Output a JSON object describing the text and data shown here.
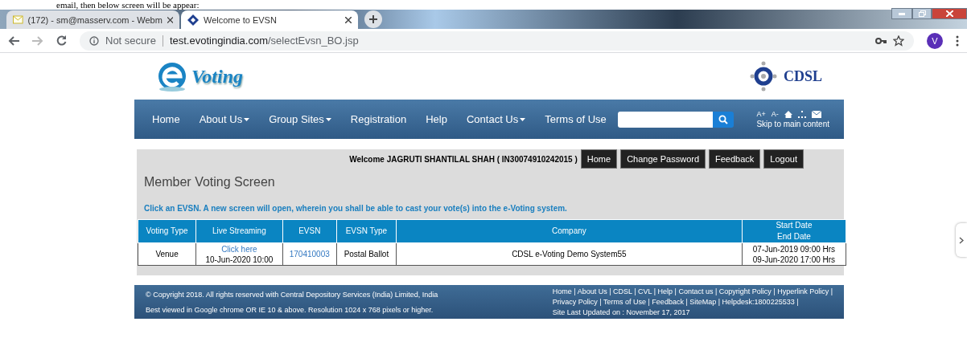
{
  "document_line": "email, then below screen will be appear:",
  "browser": {
    "tabs": [
      {
        "title": "(172) - sm@masserv.com - Webm",
        "selected": false,
        "kind": "mail"
      },
      {
        "title": "Welcome to EVSN",
        "selected": true,
        "kind": "site"
      }
    ],
    "security": "Not secure",
    "url_host": "test.evotingindia.com",
    "url_path": "/selectEvsn_BO.jsp",
    "profile": "V"
  },
  "header": {
    "logo_text": "Voting",
    "brand": "CDSL"
  },
  "nav": {
    "items": [
      {
        "label": "Home",
        "dropdown": false
      },
      {
        "label": "About Us",
        "dropdown": true
      },
      {
        "label": "Group Sites",
        "dropdown": true
      },
      {
        "label": "Registration",
        "dropdown": false
      },
      {
        "label": "Help",
        "dropdown": false
      },
      {
        "label": "Contact Us",
        "dropdown": true
      },
      {
        "label": "Terms of Use",
        "dropdown": false
      }
    ],
    "font_up": "A+",
    "font_down": "A-",
    "skip_link": "Skip to main content"
  },
  "panel": {
    "welcome": "Welcome JAGRUTI SHANTILAL SHAH ( IN30074910242015 )",
    "buttons": [
      "Home",
      "Change Password",
      "Feedback",
      "Logout"
    ],
    "title": "Member Voting Screen",
    "instruction": "Click an EVSN. A new screen will open, wherein you shall be able to cast your vote(s) into the e-Voting system.",
    "table": {
      "columns": [
        "Voting Type",
        "Live Streaming",
        "EVSN",
        "EVSN Type",
        "Company",
        [
          "Start Date",
          "End Date"
        ]
      ],
      "rows": [
        {
          "voting_type": "Venue",
          "live_link": "Click here",
          "live_time": "10-Jun-2020 10:00",
          "evsn": "170410003",
          "evsn_type": "Postal Ballot",
          "company": "CDSL e-Voting Demo System55",
          "start": "07-Jun-2019 09:00 Hrs",
          "end": "09-Jun-2020 17:00 Hrs"
        }
      ]
    }
  },
  "footer": {
    "copyright": "© Copyright 2018. All rights reserved with Central Depository Services (India) Limited, India",
    "best_viewed": "Best viewed in Google chrome OR IE 10 & above. Resolution 1024 x 768 pixels or higher.",
    "links_lines": [
      "Home | About Us | CDSL | CVL | Help | Contact us | Copyright Policy | Hyperlink Policy |",
      "Privacy Policy | Terms of Use | Feedback | SiteMap | Helpdesk:1800225533 |"
    ],
    "updated": "Site Last Updated on : November 17, 2017"
  }
}
